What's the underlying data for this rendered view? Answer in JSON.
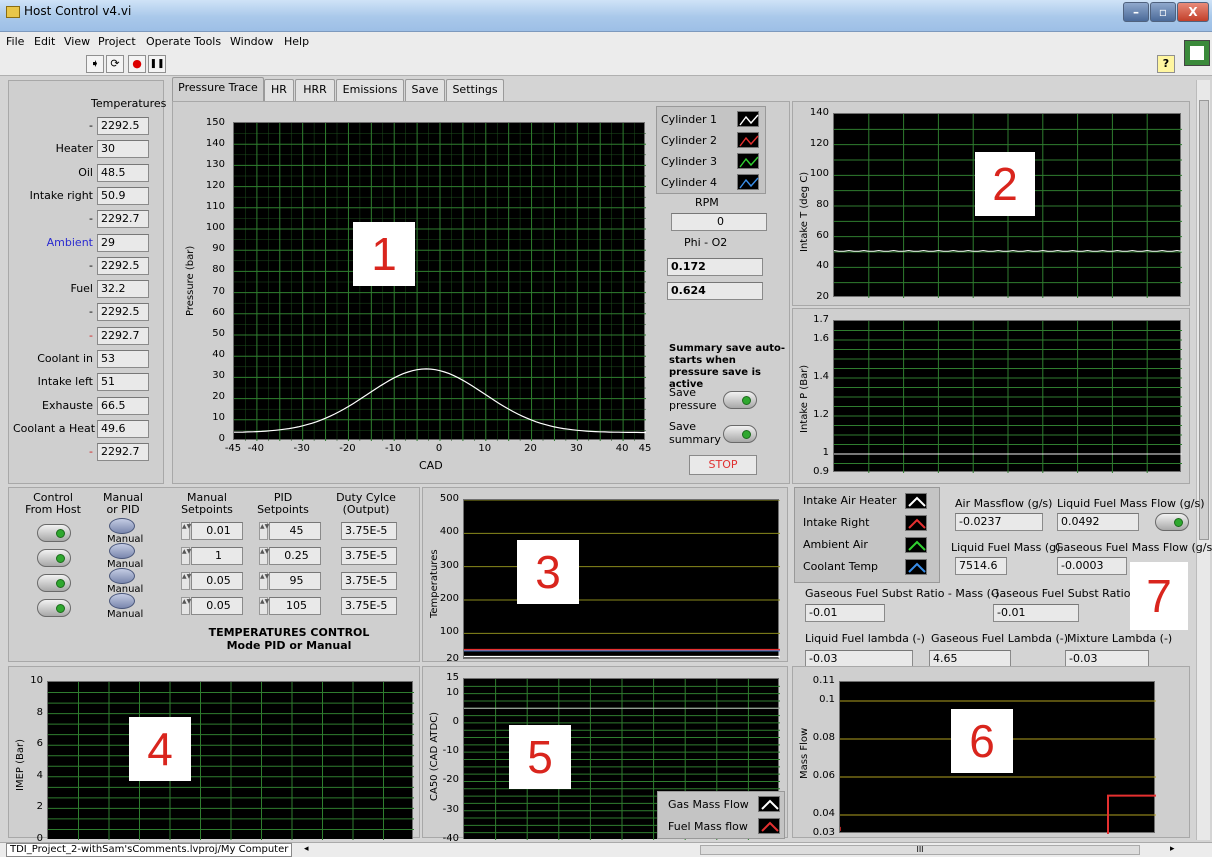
{
  "window": {
    "title": "Host Control v4.vi",
    "minimize": "–",
    "maximize": "▫",
    "close": "X"
  },
  "menu": [
    "File",
    "Edit",
    "View",
    "Project",
    "Operate",
    "Tools",
    "Window",
    "Help"
  ],
  "toolbar": {
    "run": "➧",
    "run_cont": "⟳",
    "abort": "●",
    "pause": "❚❚",
    "help": "?"
  },
  "tabs": [
    "Pressure Trace",
    "HR",
    "HRR",
    "Emissions",
    "Save",
    "Settings"
  ],
  "temps": {
    "header": "Temperatures",
    "rows": [
      {
        "label": "-",
        "value": "2292.5"
      },
      {
        "label": "Heater",
        "value": "30"
      },
      {
        "label": "Oil",
        "value": "48.5"
      },
      {
        "label": "Intake right",
        "value": "50.9"
      },
      {
        "label": "-",
        "value": "2292.7"
      },
      {
        "label": "Ambient",
        "value": "29"
      },
      {
        "label": "-",
        "value": "2292.5"
      },
      {
        "label": "Fuel",
        "value": "32.2"
      },
      {
        "label": "-",
        "value": "2292.5"
      },
      {
        "label": "-",
        "value": "2292.7"
      },
      {
        "label": "Coolant in",
        "value": "53"
      },
      {
        "label": "Intake left",
        "value": "51"
      },
      {
        "label": "Exhauste",
        "value": "66.5"
      },
      {
        "label": "Coolant a Heat",
        "value": "49.6"
      },
      {
        "label": "-",
        "value": "2292.7"
      }
    ]
  },
  "pressure": {
    "ylabel": "Pressure (bar)",
    "xlabel": "CAD",
    "yticks": [
      "150",
      "140",
      "130",
      "120",
      "110",
      "100",
      "90",
      "80",
      "70",
      "60",
      "50",
      "40",
      "30",
      "20",
      "10",
      "0"
    ],
    "xticks": [
      "-45",
      "-40",
      "-30",
      "-20",
      "-10",
      "0",
      "10",
      "20",
      "30",
      "40",
      "45"
    ],
    "cylinders": [
      "Cylinder 1",
      "Cylinder 2",
      "Cylinder 3",
      "Cylinder 4"
    ],
    "cyl_colors": [
      "#ffffff",
      "#e53030",
      "#30d030",
      "#3a8ee8"
    ],
    "rpm_label": "RPM",
    "rpm_value": "0",
    "phi_label": "Phi - O2",
    "phi1": "0.172",
    "phi2": "0.624",
    "summary_note": "Summary save auto-starts when pressure save is active",
    "save_pressure": "Save pressure",
    "save_summary": "Save summary",
    "stop": "STOP",
    "marker": "1"
  },
  "intakeT": {
    "ylabel": "Intake T (deg C)",
    "yticks": [
      "140",
      "120",
      "100",
      "80",
      "60",
      "40",
      "20"
    ],
    "marker": "2"
  },
  "intakeP": {
    "ylabel": "Intake P (Bar)",
    "yticks": [
      "1.7",
      "1.6",
      "1.4",
      "1.2",
      "1",
      "0.9"
    ]
  },
  "control": {
    "h_control": "Control From Host",
    "h_manual": "Manual or PID",
    "h_setpoints": "Manual Setpoints",
    "h_pid": "PID Setpoints",
    "h_duty": "Duty Cylce (Output)",
    "manual_label": "Manual",
    "setpoints": [
      "0.01",
      "1",
      "0.05",
      "0.05"
    ],
    "pid": [
      "45",
      "0.25",
      "95",
      "105"
    ],
    "duty": [
      "3.75E-5",
      "3.75E-5",
      "3.75E-5",
      "3.75E-5"
    ],
    "footer1": "TEMPERATURES CONTROL",
    "footer2": "Mode PID or Manual"
  },
  "tempsPlot": {
    "ylabel": "Temperatures",
    "yticks": [
      "500",
      "400",
      "300",
      "200",
      "100",
      "20"
    ],
    "marker": "3",
    "legend": [
      "Intake Air Heater",
      "Intake Right",
      "Ambient Air",
      "Coolant Temp"
    ],
    "legend_colors": [
      "#ffffff",
      "#e53030",
      "#30d030",
      "#3a8ee8"
    ]
  },
  "flows": {
    "air_label": "Air Massflow (g/s)",
    "air": "-0.0237",
    "lff_label": "Liquid Fuel Mass Flow (g/s)",
    "lff": "0.0492",
    "lfm_label": "Liquid Fuel Mass (g)",
    "lfm": "7514.6",
    "gff_label": "Gaseous Fuel Mass Flow (g/s",
    "gff": "-0.0003",
    "gsr_mass_label": "Gaseous Fuel Subst Ratio - Mass (-)",
    "gsr_mass": "-0.01",
    "gsr_label": "Gaseous Fuel Subst Ratio -",
    "gsr": "-0.01",
    "llambda_label": "Liquid Fuel lambda (-)",
    "llambda": "-0.03",
    "glambda_label": "Gaseous Fuel Lambda (-)",
    "glambda": "4.65",
    "mlambda_label": "Mixture Lambda (-)",
    "mlambda": "-0.03",
    "marker": "7"
  },
  "imep": {
    "ylabel": "IMEP (Bar)",
    "yticks": [
      "10",
      "8",
      "6",
      "4",
      "2",
      "0"
    ],
    "marker": "4"
  },
  "ca50": {
    "ylabel": "CA50 (CAD ATDC)",
    "yticks": [
      "15",
      "10",
      "0",
      "-10",
      "-20",
      "-30",
      "-40"
    ],
    "marker": "5",
    "legend": [
      "Gas Mass Flow",
      "Fuel Mass flow"
    ],
    "legend_colors": [
      "#ffffff",
      "#e53030"
    ]
  },
  "massflow": {
    "ylabel": "Mass Flow",
    "yticks": [
      "0.11",
      "0.1",
      "0.08",
      "0.06",
      "0.04",
      "0.03"
    ],
    "marker": "6"
  },
  "status": {
    "path": "TDI_Project_2-withSam'sComments.lvproj/My Computer",
    "scroll_mid": "III"
  }
}
